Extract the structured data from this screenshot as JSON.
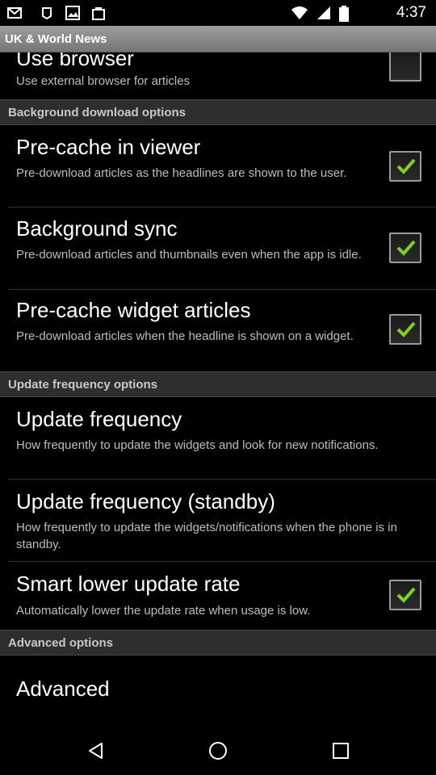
{
  "status_bar": {
    "time": "4:37",
    "left_icons": [
      "email-icon",
      "notification-icon",
      "image-icon",
      "bag-icon"
    ],
    "right_icons": [
      "wifi-icon",
      "signal-icon",
      "battery-icon"
    ]
  },
  "app": {
    "title": "UK & World News"
  },
  "settings": {
    "use_browser": {
      "title": "Use browser",
      "summary": "Use external browser for articles",
      "checked": false
    },
    "section_background": "Background download options",
    "precache_viewer": {
      "title": "Pre-cache in viewer",
      "summary": "Pre-download articles as the headlines are shown to the user.",
      "checked": true
    },
    "background_sync": {
      "title": "Background sync",
      "summary": "Pre-download articles and thumbnails even when the app is idle.",
      "checked": true
    },
    "precache_widget": {
      "title": "Pre-cache widget articles",
      "summary": "Pre-download articles when the headline is shown on a widget.",
      "checked": true
    },
    "section_update": "Update frequency options",
    "update_frequency": {
      "title": "Update frequency",
      "summary": "How frequently to update the widgets and look for new notifications."
    },
    "update_frequency_standby": {
      "title": "Update frequency (standby)",
      "summary": "How frequently to update the widgets/notifications when the phone is in standby."
    },
    "smart_lower": {
      "title": "Smart lower update rate",
      "summary": "Automatically lower the update rate when usage is low.",
      "checked": true
    },
    "section_advanced": "Advanced options",
    "advanced": {
      "title": "Advanced"
    }
  },
  "nav": {
    "buttons": [
      "back-icon",
      "home-icon",
      "recents-icon"
    ]
  },
  "colors": {
    "check": "#7ed321",
    "background": "#000000",
    "section_bg": "#2e2e2e",
    "title_bar": "#8a8a8a"
  }
}
